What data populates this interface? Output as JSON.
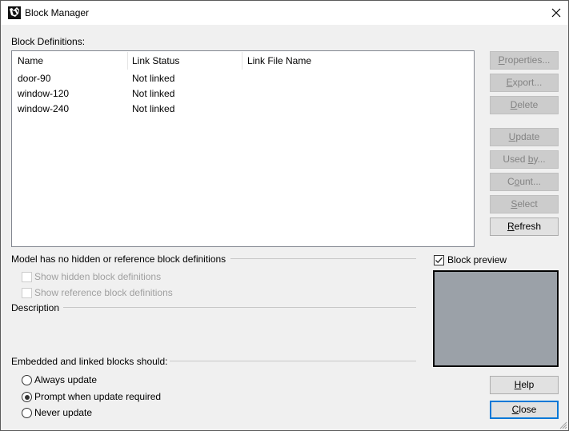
{
  "window": {
    "title": "Block Manager",
    "app_icon": "rhino-icon",
    "close_icon": "close-icon"
  },
  "definitions": {
    "label": "Block Definitions:",
    "columns": [
      "Name",
      "Link Status",
      "Link File Name"
    ],
    "rows": [
      {
        "name": "door-90",
        "link_status": "Not linked",
        "link_file": ""
      },
      {
        "name": "window-120",
        "link_status": "Not linked",
        "link_file": ""
      },
      {
        "name": "window-240",
        "link_status": "Not linked",
        "link_file": ""
      }
    ]
  },
  "buttons": {
    "properties": {
      "pre": "",
      "key": "P",
      "post": "roperties...",
      "enabled": false
    },
    "export": {
      "pre": "",
      "key": "E",
      "post": "xport...",
      "enabled": false
    },
    "delete": {
      "pre": "",
      "key": "D",
      "post": "elete",
      "enabled": false
    },
    "update": {
      "pre": "",
      "key": "U",
      "post": "pdate",
      "enabled": false
    },
    "used_by": {
      "pre": "Used ",
      "key": "b",
      "post": "y...",
      "enabled": false
    },
    "count": {
      "pre": "C",
      "key": "o",
      "post": "unt...",
      "enabled": false
    },
    "select": {
      "pre": "",
      "key": "S",
      "post": "elect",
      "enabled": false
    },
    "refresh": {
      "pre": "",
      "key": "R",
      "post": "efresh",
      "enabled": true
    },
    "help": {
      "pre": "",
      "key": "H",
      "post": "elp",
      "enabled": true
    },
    "close": {
      "pre": "",
      "key": "C",
      "post": "lose",
      "enabled": true
    }
  },
  "hidden_group": {
    "label": "Model has no hidden or reference block definitions",
    "show_hidden": {
      "label": "Show hidden block definitions",
      "checked": false,
      "enabled": false
    },
    "show_reference": {
      "label": "Show reference block definitions",
      "checked": false,
      "enabled": false
    }
  },
  "description": {
    "label": "Description",
    "value": ""
  },
  "preview": {
    "label": "Block preview",
    "checked": true
  },
  "update_policy": {
    "label": "Embedded and linked blocks should:",
    "options": [
      {
        "label": "Always update",
        "selected": false
      },
      {
        "label": "Prompt when update required",
        "selected": true
      },
      {
        "label": "Never update",
        "selected": false
      }
    ]
  },
  "colors": {
    "accent": "#0078d7",
    "preview_bg": "#9ba1a8",
    "dialog_bg": "#f0f0f0"
  }
}
